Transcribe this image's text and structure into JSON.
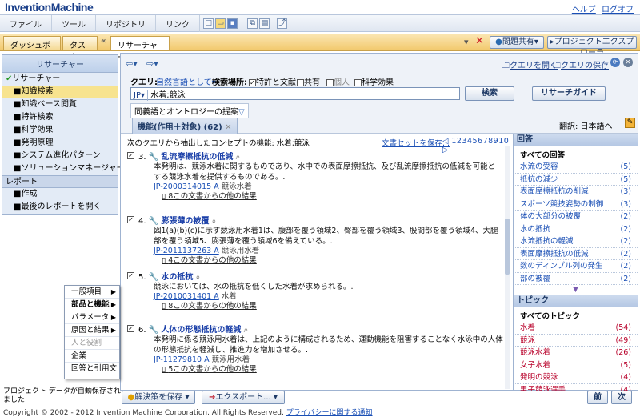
{
  "app": {
    "logo": "InventionMachine",
    "links": [
      "ヘルプ",
      "ログオフ"
    ]
  },
  "menu": [
    "ファイル",
    "ツール",
    "リポジトリ",
    "リンク"
  ],
  "tabs": {
    "items": [
      "ダッシュボード",
      "タスク",
      "リサーチャー"
    ],
    "close": "×",
    "share": "問題共有",
    "explorer": "プロジェクトエクスプローラ"
  },
  "sidebar": {
    "title": "リサーチャー",
    "items": [
      {
        "label": "リサーチャー",
        "kind": "check"
      },
      {
        "label": "知識検索",
        "kind": "sel"
      },
      {
        "label": "知識ベース閲覧",
        "kind": "sub"
      },
      {
        "label": "特許検索",
        "kind": "sub"
      },
      {
        "label": "科学効果",
        "kind": "sub"
      },
      {
        "label": "発明原理",
        "kind": "sub"
      },
      {
        "label": "システム進化パターン",
        "kind": "sub"
      },
      {
        "label": "ソリューションマネージャー",
        "kind": "sub"
      },
      {
        "label": "レポート",
        "kind": "sec"
      },
      {
        "label": "作成",
        "kind": "sub"
      },
      {
        "label": "最後のレポートを開く",
        "kind": "sub"
      }
    ]
  },
  "query": {
    "open": "クエリを開く",
    "save": "クエリの保存",
    "label": "クエリ:",
    "lang": "自然言語として",
    "place_label": "検索場所:",
    "checks": [
      "特許と文献",
      "共有",
      "個人",
      "科学効果"
    ],
    "lang_code": "JP",
    "value": "水着;競泳",
    "search_btn": "検索",
    "guide_btn": "リサーチガイド",
    "suggest": "同義語とオントロジーの提案"
  },
  "results": {
    "tab": "機能(作用＋対象) (62)",
    "translate": "翻訳: 日本語へ",
    "header": "次のクエリから抽出したコンセプトの機能: 水着;競泳",
    "saveset": "文書セットを保存...",
    "pages": "12345678910",
    "items": [
      {
        "num": "3.",
        "title": "乱流摩擦抵抗の低減",
        "body1": "本発明は、",
        "body2": "競泳水着に関するものであり、水中での表面摩擦抵抗、及び乱流摩擦抵抗の低減を可能と",
        "body3": "する競泳水着を提供するものである。.",
        "id": "JP-2000314015 A",
        "idtail": "競泳水着",
        "more": "8この文書からの他の結果"
      },
      {
        "num": "4.",
        "title": "膨張薄の被覆",
        "body1": "図1(a)(b)(c)に示す競泳用水着1は、腹部を覆う領域2、臀部を覆う領域3、股間部を覆う領域4、大腿",
        "body2": "部を覆う領域5、膨張薄を覆う領域6を備えている。.",
        "body3": "",
        "id": "JP-2011137263 A",
        "idtail": "競泳用水着",
        "more": "4この文書からの他の結果"
      },
      {
        "num": "5.",
        "title": "水の抵抗",
        "body1": "競泳においては、水の抵抗を低くした水着が求められる。.",
        "body2": "",
        "body3": "",
        "id": "JP-2010031401 A",
        "idtail": "水着",
        "more": "8この文書からの他の結果"
      },
      {
        "num": "6.",
        "title": "人体の形態抵抗の軽減",
        "body1": "本発明に係る競泳用水着は、上記のように構成されるため、運動機能を阻害することなく水泳中の人体",
        "body2": "の形態抵抗を軽減し、推進力を増加させる。.",
        "body3": "",
        "id": "JP-11279810 A",
        "idtail": "競泳用水着",
        "more": "5この文書からの他の結果"
      }
    ]
  },
  "answers": {
    "title": "回答",
    "all": "すべての回答",
    "rows": [
      {
        "label": "水流の受容",
        "count": "(5)"
      },
      {
        "label": "抵抗の減少",
        "count": "(5)"
      },
      {
        "label": "表面摩擦抵抗の削減",
        "count": "(3)"
      },
      {
        "label": "スポーツ競技姿勢の制御",
        "count": "(3)"
      },
      {
        "label": "体の大部分の被覆",
        "count": "(2)"
      },
      {
        "label": "水の抵抗",
        "count": "(2)"
      },
      {
        "label": "水流抵抗の軽減",
        "count": "(2)"
      },
      {
        "label": "表面摩擦抵抗の低減",
        "count": "(2)"
      },
      {
        "label": "数のディンプル列の発生",
        "count": "(2)"
      },
      {
        "label": "部の被覆",
        "count": "(2)"
      }
    ]
  },
  "topics": {
    "title": "トピック",
    "all": "すべてのトピック",
    "rows": [
      {
        "label": "水着",
        "count": "(54)"
      },
      {
        "label": "競泳",
        "count": "(49)"
      },
      {
        "label": "競泳水着",
        "count": "(26)"
      },
      {
        "label": "女子水着",
        "count": "(5)"
      },
      {
        "label": "発明の競泳",
        "count": "(4)"
      },
      {
        "label": "男子競泳選手",
        "count": "(4)"
      }
    ]
  },
  "popup": {
    "items": [
      {
        "label": "一般項目",
        "arrow": true,
        "bold": false,
        "dim": false
      },
      {
        "label": "部品と機能",
        "arrow": true,
        "bold": true,
        "dim": false
      },
      {
        "label": "パラメータ",
        "arrow": true,
        "bold": false,
        "dim": false
      },
      {
        "label": "原因と結果",
        "arrow": true,
        "bold": false,
        "dim": false
      },
      {
        "label": "人と役割",
        "arrow": false,
        "bold": false,
        "dim": true
      },
      {
        "label": "企業",
        "arrow": false,
        "bold": false,
        "dim": false
      },
      {
        "label": "回答と引用文",
        "arrow": false,
        "bold": false,
        "dim": false
      }
    ]
  },
  "bottom": {
    "status": "プロジェクト データが自動保存されました",
    "solution": "解決策を保存",
    "export": "エクスポート...",
    "prev": "前",
    "next": "次"
  },
  "footer": {
    "text": "Copyright © 2002 - 2012 Invention Machine Corporation. All Rights Reserved.",
    "privacy": "プライバシーに関する通知"
  }
}
